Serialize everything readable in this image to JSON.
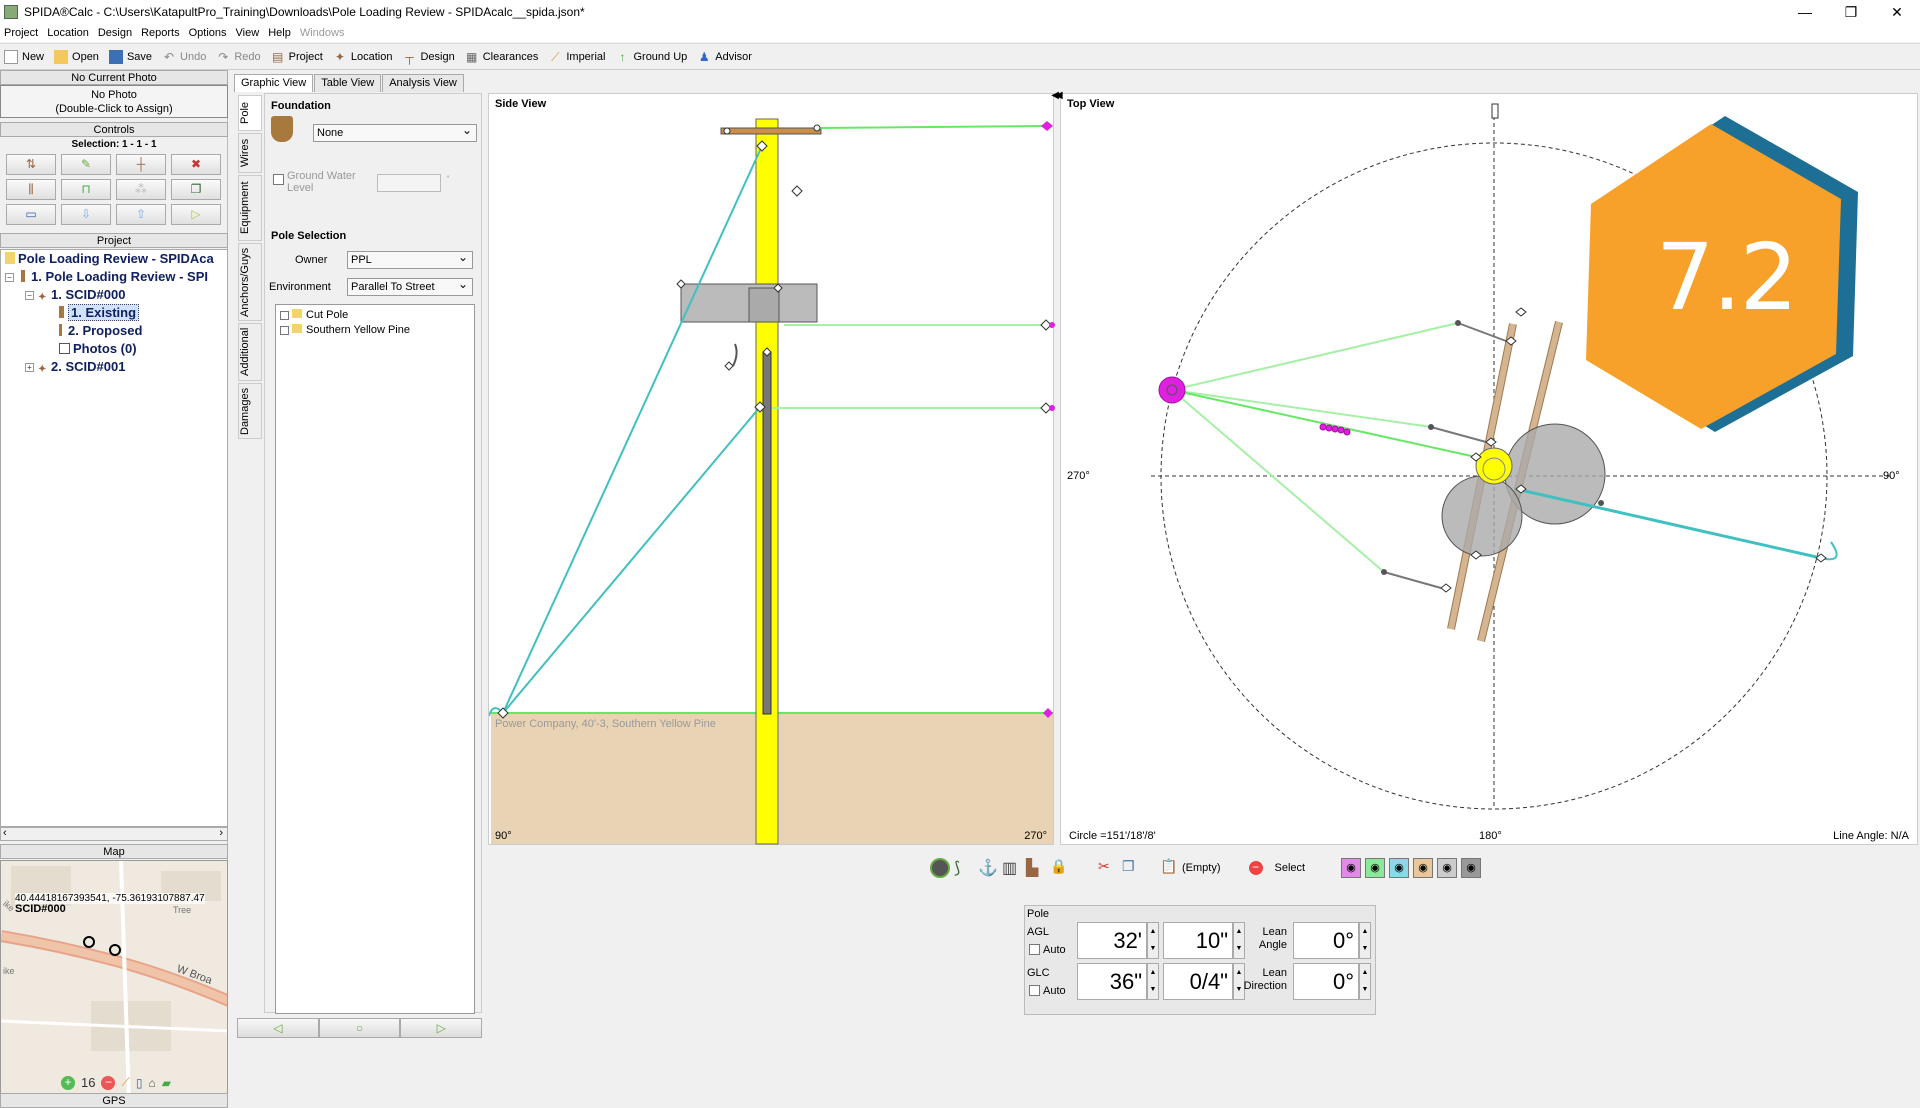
{
  "window": {
    "title": "SPIDA®Calc - C:\\Users\\KatapultPro_Training\\Downloads\\Pole Loading Review - SPIDAcalc__spida.json*",
    "controls": [
      "—",
      "❐",
      "✕"
    ]
  },
  "menu": [
    "Project",
    "Location",
    "Design",
    "Reports",
    "Options",
    "View",
    "Help",
    "Windows"
  ],
  "toolbar": {
    "new": "New",
    "open": "Open",
    "save": "Save",
    "undo": "Undo",
    "redo": "Redo",
    "project": "Project",
    "location": "Location",
    "design": "Design",
    "clearances": "Clearances",
    "imperial": "Imperial",
    "ground_up": "Ground Up",
    "advisor": "Advisor"
  },
  "photo": {
    "header": "No Current Photo",
    "line1": "No Photo",
    "line2": "(Double-Click to Assign)"
  },
  "controls": {
    "header": "Controls",
    "selection": "Selection: 1 - 1 - 1"
  },
  "project": {
    "header": "Project",
    "nodes": [
      "Pole Loading Review - SPIDAca",
      "1. Pole Loading Review - SPI",
      "1. SCID#000",
      "1. Existing",
      "2. Proposed",
      "Photos (0)",
      "2. SCID#001"
    ]
  },
  "map": {
    "header": "Map",
    "coords": "40.44418167393541, -75.36193107887.47",
    "label": "SCID#000",
    "road": "W Broa",
    "tree": "Tree",
    "ike1": "ike",
    "ike2": "ike",
    "zoom": "16"
  },
  "gps": {
    "header": "GPS"
  },
  "tabs": [
    "Graphic View",
    "Table View",
    "Analysis View"
  ],
  "vtabs": [
    "Pole",
    "Wires",
    "Equipment",
    "Anchors/Guys",
    "Additional",
    "Damages"
  ],
  "foundation": {
    "title": "Foundation",
    "value": "None",
    "gwl_label1": "Ground Water",
    "gwl_label2": "Level",
    "unit": "'"
  },
  "pole_selection": {
    "title": "Pole Selection",
    "owner_label": "Owner",
    "owner": "PPL",
    "env_label": "Environment",
    "environment": "Parallel To Street",
    "list": [
      "Cut Pole",
      "Southern Yellow Pine"
    ]
  },
  "side_view": {
    "title": "Side View",
    "ground_text": "Power Company, 40'-3, Southern Yellow Pine",
    "left_angle": "90°",
    "right_angle": "270°"
  },
  "top_view": {
    "title": "Top View",
    "left": "270°",
    "right": "90°",
    "bottom": "180°",
    "circle": "Circle =151'/18'/8'",
    "line_angle": "Line Angle: N/A",
    "version": "7.2"
  },
  "viewbar": {
    "empty": "(Empty)",
    "select": "Select"
  },
  "pole_box": {
    "title": "Pole",
    "agl": "AGL",
    "glc": "GLC",
    "auto": "Auto",
    "agl_ft": "32'",
    "agl_in": "10\"",
    "glc_ft": "36\"",
    "glc_in": "0/4\"",
    "lean_angle_label1": "Lean",
    "lean_angle_label2": "Angle",
    "lean_angle": "0°",
    "lean_dir_label1": "Lean",
    "lean_dir_label2": "Direction",
    "lean_dir": "0°"
  },
  "colors": {
    "wire": "#66e866",
    "guy": "#40c0c0",
    "pole": "#ffff00",
    "ground": "#e8d3b5",
    "badge": "#f7a12b"
  }
}
